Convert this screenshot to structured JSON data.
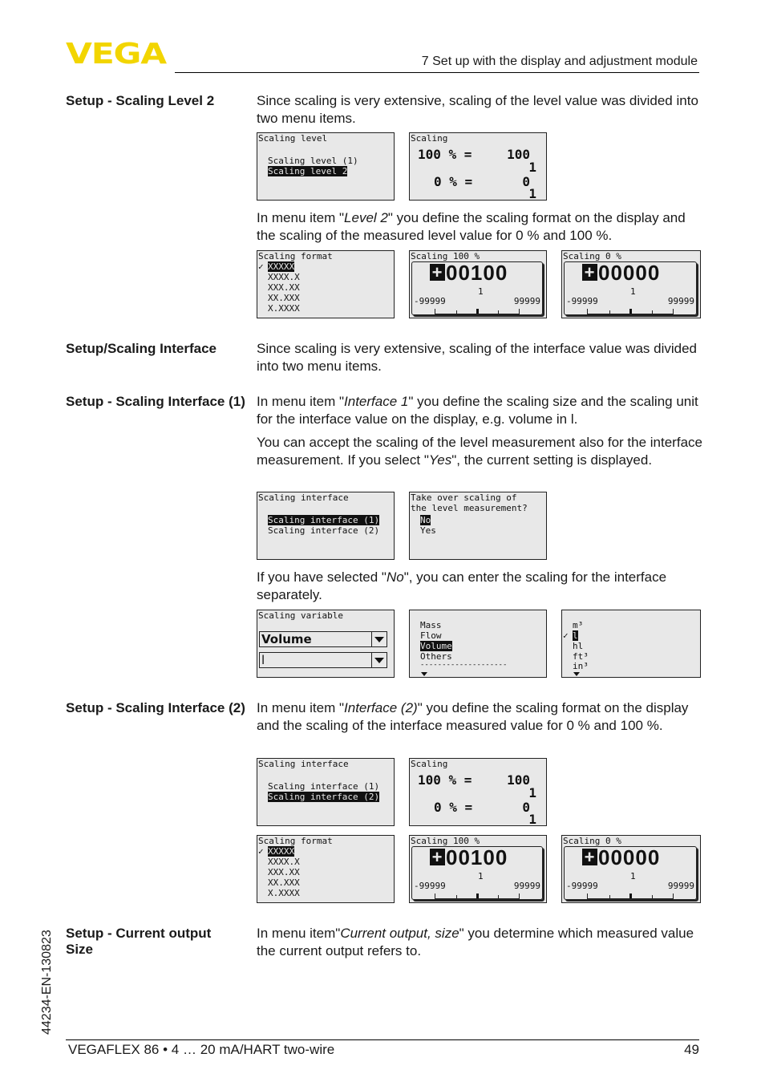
{
  "header": {
    "logo": "VEGA",
    "chapter": "7 Set up with the display and adjustment module"
  },
  "sections": {
    "level2": {
      "label": "Setup - Scaling Level 2",
      "p1": "Since scaling is very extensive, scaling of the level value was divided into two menu items.",
      "p2_pre": "In menu item \"",
      "p2_em": "Level 2",
      "p2_post": "\" you define the scaling format on the display and the scaling of the measured level value for 0 % and 100 %."
    },
    "interface": {
      "label": "Setup/Scaling Interface",
      "p1": "Since scaling is very extensive, scaling of the interface value was divided into two menu items."
    },
    "interface1": {
      "label": "Setup - Scaling Interface (1)",
      "p1_pre": "In menu item \"",
      "p1_em": "Interface 1",
      "p1_post": "\" you define the scaling size and the scaling unit for the interface value on the display, e.g. volume in l.",
      "p2_pre": "You can accept the scaling of the level measurement also for the interface measurement. If you select \"",
      "p2_em": "Yes",
      "p2_post": "\", the current setting is displayed.",
      "p3_pre": "If you have selected \"",
      "p3_em": "No",
      "p3_post": "\", you can enter the scaling for the interface separately."
    },
    "interface2": {
      "label": "Setup - Scaling Interface (2)",
      "p1_pre": "In menu item \"",
      "p1_em": "Interface (2)",
      "p1_post": "\" you define the scaling format on the display and the scaling of the interface measured value for 0 % and 100 %."
    },
    "current": {
      "label": "Setup - Current output Size",
      "p1_pre": "In menu item\"",
      "p1_em": "Current output, size",
      "p1_post": "\" you determine which measured value the current output refers to."
    }
  },
  "screens": {
    "scaling_level": {
      "title": "Scaling level",
      "items": [
        "Scaling level (1)",
        "Scaling level 2"
      ],
      "selected": 1
    },
    "scaling": {
      "title": "Scaling",
      "r1_pct": "100 % =",
      "r1_val": "100",
      "r1_unit": "1",
      "r2_pct": "0 % =",
      "r2_val": "0",
      "r2_unit": "1"
    },
    "scaling_format": {
      "title": "Scaling format",
      "check": "✓",
      "items": [
        "XXXXX",
        "XXXX.X",
        "XXX.XX",
        "XX.XXX",
        "X.XXXX"
      ],
      "selected": 0
    },
    "scaling_100": {
      "title": "Scaling 100 %",
      "sign": "+",
      "value": "00100",
      "unit": "1",
      "min": "-99999",
      "max": "99999"
    },
    "scaling_0": {
      "title": "Scaling 0 %",
      "sign": "+",
      "value": "00000",
      "unit": "1",
      "min": "-99999",
      "max": "99999"
    },
    "scaling_interface_1": {
      "title": "Scaling interface",
      "items": [
        "Scaling interface (1)",
        "Scaling interface (2)"
      ],
      "selected": 0
    },
    "take_over": {
      "title1": "Take over scaling of",
      "title2": "the level measurement?",
      "items": [
        "No",
        "Yes"
      ],
      "selected": 0
    },
    "scaling_variable": {
      "title": "Scaling variable",
      "variable": "Volume",
      "unit": "l"
    },
    "variable_list": {
      "items": [
        "Mass",
        "Flow",
        "Volume",
        "Others"
      ],
      "selected": 2,
      "separator": "--------------------"
    },
    "unit_list": {
      "check": "✓",
      "items": [
        "m³",
        "l",
        "hl",
        "ft³",
        "in³"
      ],
      "selected": 1
    },
    "scaling_interface_2": {
      "title": "Scaling interface",
      "items": [
        "Scaling interface (1)",
        "Scaling interface (2)"
      ],
      "selected": 1
    }
  },
  "footer": {
    "product": "VEGAFLEX 86 • 4 … 20 mA/HART two-wire",
    "page": "49",
    "doc_id": "44234-EN-130823"
  }
}
